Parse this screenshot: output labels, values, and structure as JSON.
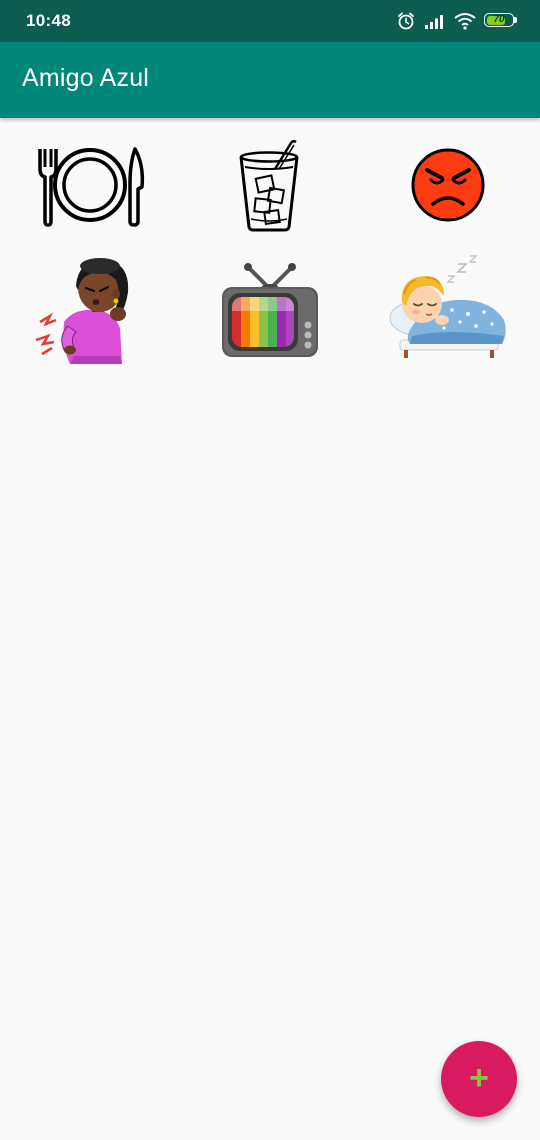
{
  "status_bar": {
    "time": "10:48",
    "battery_level": "70",
    "icons": [
      "alarm-icon",
      "signal-icon",
      "wifi-icon",
      "battery-icon"
    ]
  },
  "app_bar": {
    "title": "Amigo Azul"
  },
  "grid": {
    "items": [
      {
        "icon": "plate-cutlery-icon"
      },
      {
        "icon": "glass-drink-icon"
      },
      {
        "icon": "angry-face-icon"
      },
      {
        "icon": "girl-pain-icon"
      },
      {
        "icon": "television-icon"
      },
      {
        "icon": "sleeping-child-icon"
      }
    ]
  },
  "fab": {
    "label": "+",
    "icon": "plus-icon"
  },
  "colors": {
    "status_bar": "#0d5c50",
    "app_bar": "#00877a",
    "fab": "#d81b60",
    "fab_icon": "#8bc34a",
    "background": "#fafafa"
  }
}
